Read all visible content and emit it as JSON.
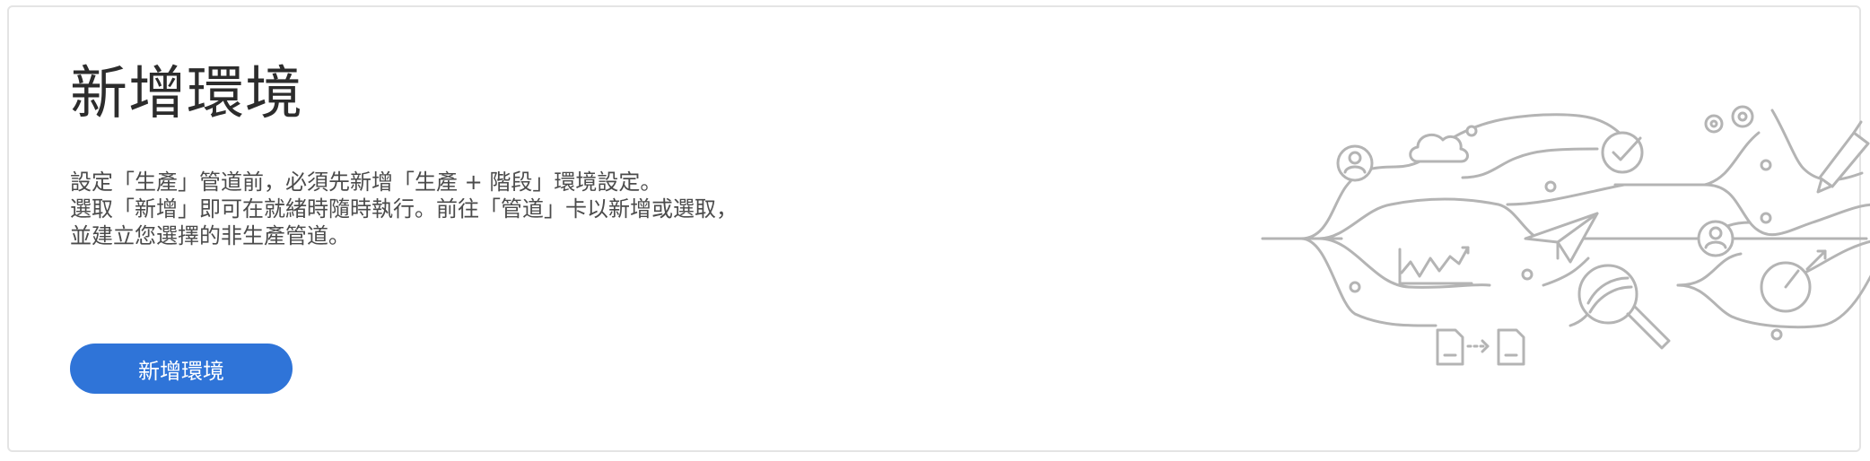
{
  "card": {
    "title": "新增環境",
    "description_lines": [
      "設定「生產」管道前，必須先新增「生產 + 階段」環境設定。",
      "選取「新增」即可在就緒時隨時執行。前往「管道」卡以新增或選取，",
      "並建立您選擇的非生產管道。"
    ],
    "button_label": "新增環境"
  },
  "colors": {
    "button": "#2f74d8",
    "illustration_stroke": "#b4b4b4",
    "title_text": "#2c2c2c"
  },
  "illustration_icons": [
    "user-icon",
    "cloud-icon",
    "checkmark-icon",
    "gear-icon",
    "pen-icon",
    "paper-plane-icon",
    "chart-icon",
    "magnifier-icon",
    "gauge-icon",
    "document-icon"
  ]
}
